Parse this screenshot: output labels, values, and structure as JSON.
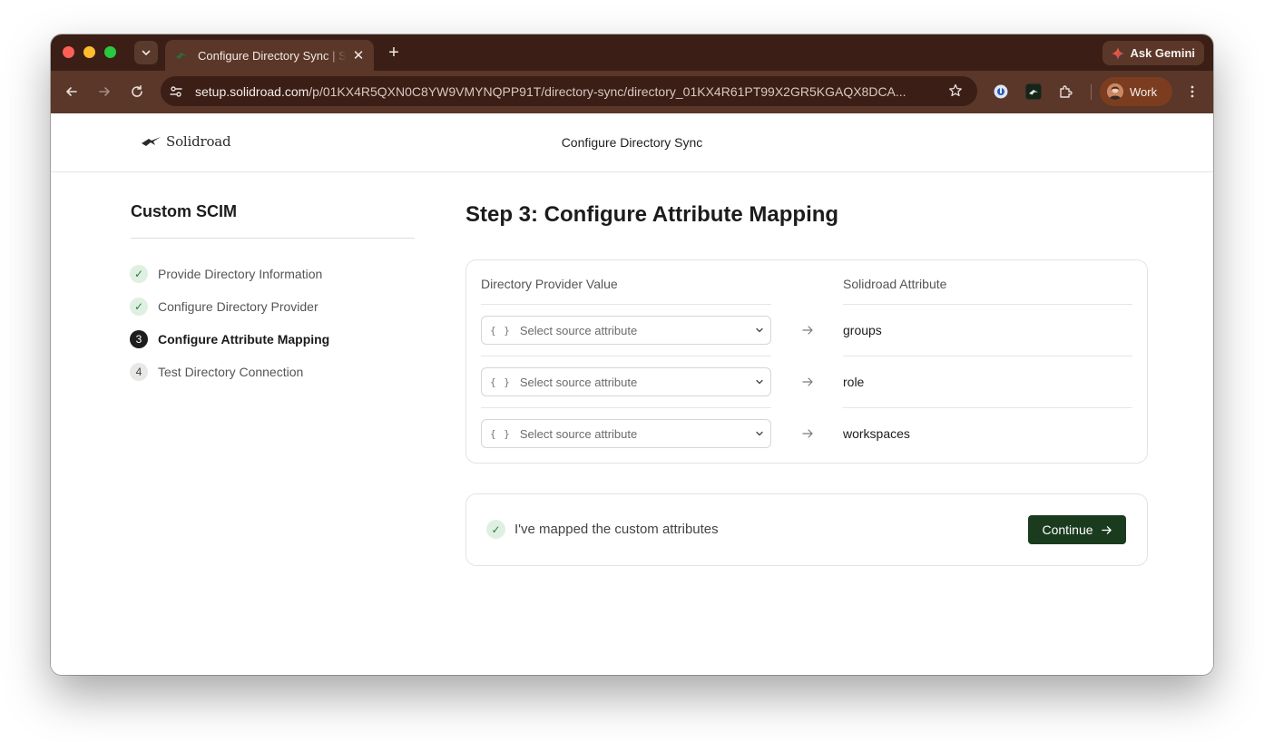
{
  "browser": {
    "tab_title": "Configure Directory Sync | Solidroad",
    "new_tab_icon": "plus-icon",
    "gemini_label": "Ask Gemini",
    "url_host": "setup.solidroad.com",
    "url_path": "/p/01KX4R5QXN0C8YW9VMYNQPP91T/directory-sync/directory_01KX4R61PT99X2GR5KGAQX8DCA...",
    "profile_label": "Work"
  },
  "app": {
    "logo_text": "Solidroad",
    "header_title": "Configure Directory Sync"
  },
  "sidebar": {
    "title": "Custom SCIM",
    "steps": [
      {
        "badge": "✓",
        "label": "Provide Directory Information",
        "state": "done"
      },
      {
        "badge": "✓",
        "label": "Configure Directory Provider",
        "state": "done"
      },
      {
        "badge": "3",
        "label": "Configure Attribute Mapping",
        "state": "active"
      },
      {
        "badge": "4",
        "label": "Test Directory Connection",
        "state": "pending"
      }
    ]
  },
  "main": {
    "title": "Step 3: Configure Attribute Mapping",
    "mapping": {
      "source_header": "Directory Provider Value",
      "dest_header": "Solidroad Attribute",
      "rows": [
        {
          "brace": "{ }",
          "placeholder": "Select source attribute",
          "destination": "groups"
        },
        {
          "brace": "{ }",
          "placeholder": "Select source attribute",
          "destination": "role"
        },
        {
          "brace": "{ }",
          "placeholder": "Select source attribute",
          "destination": "workspaces"
        }
      ]
    },
    "confirm": {
      "check": "✓",
      "text": "I've mapped the custom attributes",
      "button_label": "Continue"
    }
  },
  "colors": {
    "tabstrip": "#3b1e15",
    "toolbar": "#5a3729",
    "continue_button": "#1b3b1f",
    "done_badge": "#dff0e2"
  }
}
